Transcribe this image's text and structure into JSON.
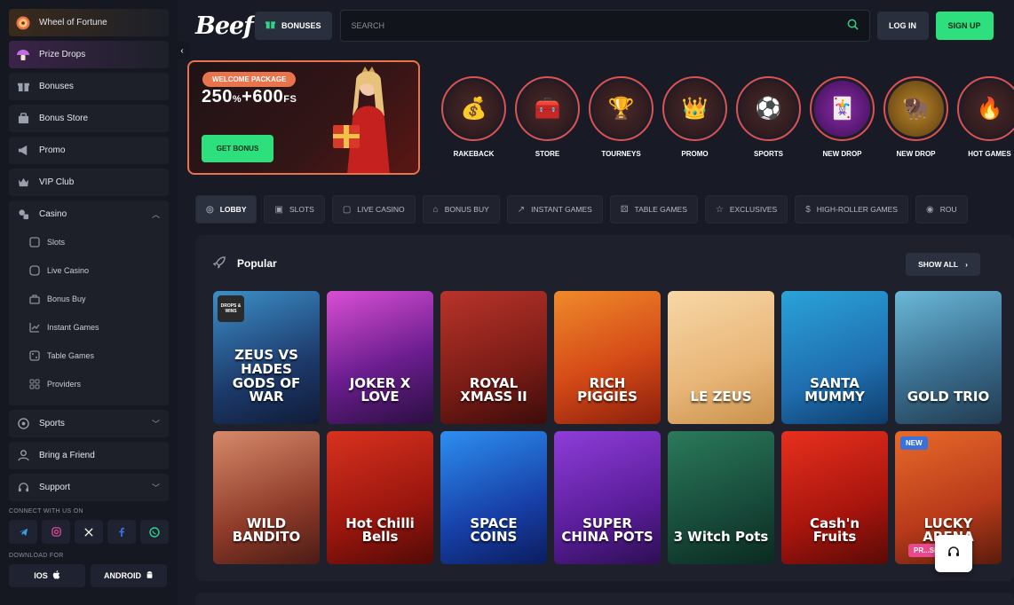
{
  "sidebar": {
    "top_items": [
      {
        "label": "Wheel of Fortune",
        "icon": "wheel-icon"
      },
      {
        "label": "Prize Drops",
        "icon": "mushroom-icon"
      },
      {
        "label": "Bonuses",
        "icon": "gift-icon"
      },
      {
        "label": "Bonus Store",
        "icon": "store-icon"
      },
      {
        "label": "Promo",
        "icon": "megaphone-icon"
      },
      {
        "label": "VIP Club",
        "icon": "crown-icon"
      }
    ],
    "casino": {
      "label": "Casino",
      "sub_items": [
        {
          "label": "Slots",
          "icon": "slots-icon"
        },
        {
          "label": "Live Casino",
          "icon": "live-icon"
        },
        {
          "label": "Bonus Buy",
          "icon": "bag-icon"
        },
        {
          "label": "Instant Games",
          "icon": "chart-icon"
        },
        {
          "label": "Table Games",
          "icon": "dice-icon"
        },
        {
          "label": "Providers",
          "icon": "grid-icon"
        }
      ]
    },
    "sports": {
      "label": "Sports"
    },
    "bring_friend": {
      "label": "Bring a Friend"
    },
    "support": {
      "label": "Support"
    },
    "connect_label": "CONNECT WITH US ON",
    "download_label": "DOWNLOAD FOR",
    "ios_label": "IOS",
    "android_label": "ANDROID"
  },
  "topbar": {
    "logo": "Beef",
    "bonuses_label": "BONUSES",
    "search_placeholder": "SEARCH",
    "login_label": "LOG IN",
    "signup_label": "SIGN UP"
  },
  "promo": {
    "pill": "WELCOME PACKAGE",
    "amount_main": "250",
    "amount_pct": "%",
    "amount_plus": "+600",
    "amount_fs": "FS",
    "cta": "GET BONUS"
  },
  "stories": [
    {
      "label": "RAKEBACK",
      "glyph": "💰"
    },
    {
      "label": "STORE",
      "glyph": "🧰"
    },
    {
      "label": "TOURNEYS",
      "glyph": "🏆"
    },
    {
      "label": "PROMO",
      "glyph": "👑"
    },
    {
      "label": "SPORTS",
      "glyph": "⚽"
    },
    {
      "label": "NEW DROP",
      "glyph": "🃏"
    },
    {
      "label": "NEW DROP",
      "glyph": "🦬"
    },
    {
      "label": "HOT GAMES",
      "glyph": "🔥"
    }
  ],
  "categories": [
    {
      "label": "LOBBY",
      "glyph": "◎"
    },
    {
      "label": "SLOTS",
      "glyph": "▣"
    },
    {
      "label": "LIVE CASINO",
      "glyph": "▢"
    },
    {
      "label": "BONUS BUY",
      "glyph": "⌂"
    },
    {
      "label": "INSTANT GAMES",
      "glyph": "↗"
    },
    {
      "label": "TABLE GAMES",
      "glyph": "⚄"
    },
    {
      "label": "EXCLUSIVES",
      "glyph": "☆"
    },
    {
      "label": "HIGH-ROLLER GAMES",
      "glyph": "$"
    },
    {
      "label": "ROU",
      "glyph": "◉"
    }
  ],
  "popular": {
    "title": "Popular",
    "show_all": "SHOW ALL",
    "games": [
      {
        "name": "ZEUS VS HADES GODS OF WAR",
        "bg": "linear-gradient(160deg,#3b8fc8,#1d3a6b 60%,#0f1c37)",
        "badge": "DROPS & WINS"
      },
      {
        "name": "JOKER X LOVE",
        "bg": "linear-gradient(160deg,#d94fd3,#6b1d8f 55%,#2a0f40)"
      },
      {
        "name": "ROYAL XMASS II",
        "bg": "linear-gradient(160deg,#b8342a,#7a1c16 60%,#3d0c0a)"
      },
      {
        "name": "RICH PIGGIES",
        "bg": "linear-gradient(160deg,#f08a2a,#d44a17 55%,#8a1f0c)"
      },
      {
        "name": "LE ZEUS",
        "bg": "linear-gradient(160deg,#f7d7a6,#e8b577 60%,#c8904b)"
      },
      {
        "name": "SANTA MUMMY",
        "bg": "linear-gradient(160deg,#2aa3d8,#1f6fb0 60%,#0f3d6b)"
      },
      {
        "name": "GOLD TRIO",
        "bg": "linear-gradient(160deg,#6bb8d8,#3a6e8f 55%,#223a4f)"
      },
      {
        "name": "WILD BANDITO",
        "bg": "linear-gradient(160deg,#d68a6a,#8f3b2a 60%,#4a1c14)"
      },
      {
        "name": "Hot Chilli Bells",
        "bg": "linear-gradient(160deg,#d8321e,#9a160e 60%,#520a06)"
      },
      {
        "name": "SPACE COINS",
        "bg": "linear-gradient(160deg,#2d8ff0,#1740a8 60%,#0b1d5e)"
      },
      {
        "name": "SUPER CHINA POTS",
        "bg": "linear-gradient(160deg,#8f3dd8,#5a1d9a 60%,#2d0f52)"
      },
      {
        "name": "3 Witch Pots",
        "bg": "linear-gradient(160deg,#2a7a5a,#174a3a 60%,#0b2a20)"
      },
      {
        "name": "Cash'n Fruits",
        "bg": "linear-gradient(160deg,#e8301e,#a8150d 60%,#5a0a06)"
      },
      {
        "name": "LUCKY ARENA",
        "bg": "linear-gradient(160deg,#e86a2a,#b83a1a 60%,#5a1c0c)",
        "badge_new": "NEW",
        "tag": "PR...SE"
      }
    ]
  }
}
